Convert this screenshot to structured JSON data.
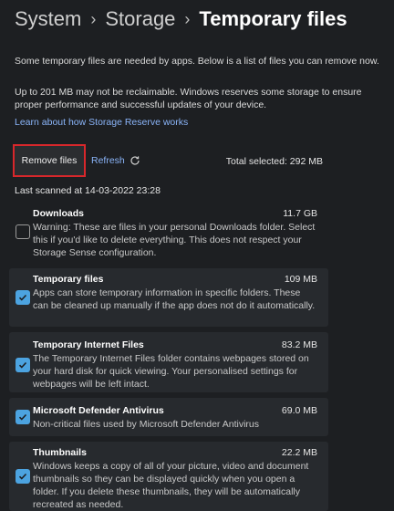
{
  "breadcrumb": {
    "root": "System",
    "parent": "Storage",
    "current": "Temporary files"
  },
  "intro": "Some temporary files are needed by apps. Below is a list of files you can remove now.",
  "reserve_note": "Up to 201 MB may not be reclaimable. Windows reserves some storage to ensure proper performance and successful updates of your device.",
  "learn_link": "Learn about how Storage Reserve works",
  "actions": {
    "remove_label": "Remove files",
    "refresh_label": "Refresh"
  },
  "total_selected": "Total selected: 292 MB",
  "last_scanned": "Last scanned at 14-03-2022 23:28",
  "colors": {
    "accent": "#4ca3e0",
    "link": "#8ab4f8",
    "highlight_border": "#d8272b"
  },
  "items": [
    {
      "title": "Downloads",
      "size": "11.7 GB",
      "checked": false,
      "desc": "Warning: These are files in your personal Downloads folder. Select this if you'd like to delete everything. This does not respect your Storage Sense configuration."
    },
    {
      "title": "Temporary files",
      "size": "109 MB",
      "checked": true,
      "desc": "Apps can store temporary information in specific folders. These can be cleaned up manually if the app does not do it automatically."
    },
    {
      "title": "Temporary Internet Files",
      "size": "83.2 MB",
      "checked": true,
      "desc": "The Temporary Internet Files folder contains webpages stored on your hard disk for quick viewing. Your personalised settings for webpages will be left intact."
    },
    {
      "title": "Microsoft Defender Antivirus",
      "size": "69.0 MB",
      "checked": true,
      "desc": "Non-critical files used by Microsoft Defender Antivirus"
    },
    {
      "title": "Thumbnails",
      "size": "22.2 MB",
      "checked": true,
      "desc": "Windows keeps a copy of all of your picture, video and document thumbnails so they can be displayed quickly when you open a folder. If you delete these thumbnails, they will be automatically recreated as needed."
    }
  ]
}
